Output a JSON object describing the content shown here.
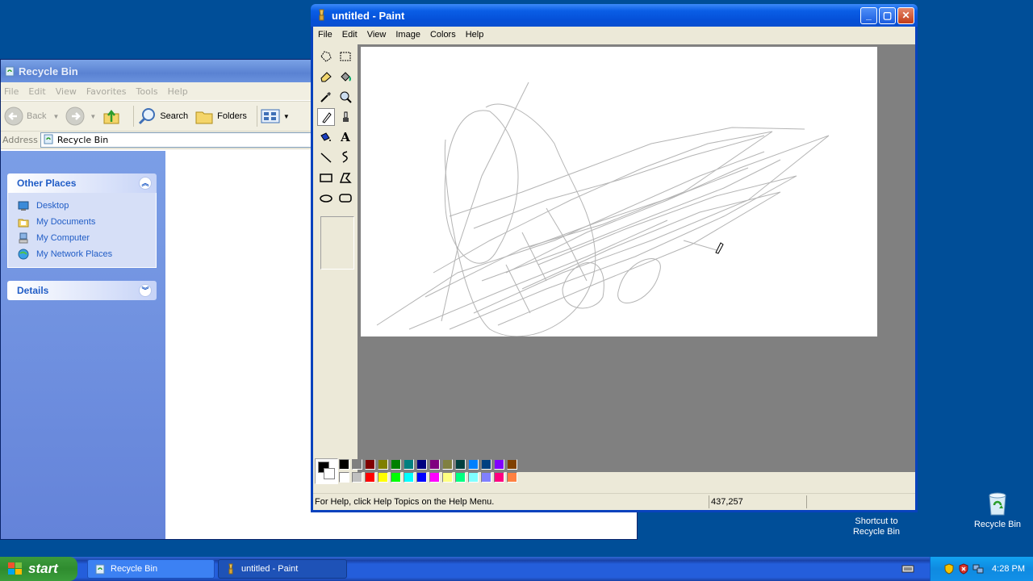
{
  "desktop": {
    "icons": [
      {
        "label": "Shortcut to Recycle Bin"
      },
      {
        "label": "Recycle Bin"
      }
    ]
  },
  "explorer": {
    "title": "Recycle Bin",
    "menu": [
      "File",
      "Edit",
      "View",
      "Favorites",
      "Tools",
      "Help"
    ],
    "toolbar": {
      "back": "Back",
      "search": "Search",
      "folders": "Folders"
    },
    "address": {
      "label": "Address",
      "value": "Recycle Bin"
    },
    "other_places": {
      "title": "Other Places",
      "items": [
        "Desktop",
        "My Documents",
        "My Computer",
        "My Network Places"
      ]
    },
    "details": {
      "title": "Details"
    }
  },
  "paint": {
    "title": "untitled - Paint",
    "menu": [
      "File",
      "Edit",
      "View",
      "Image",
      "Colors",
      "Help"
    ],
    "status": {
      "help": "For Help, click Help Topics on the Help Menu.",
      "coords": "437,257"
    },
    "palette": {
      "top": [
        "#000000",
        "#808080",
        "#800000",
        "#808000",
        "#008000",
        "#008080",
        "#000080",
        "#800080",
        "#808040",
        "#004040",
        "#0080ff",
        "#004080",
        "#8000ff",
        "#804000"
      ],
      "bottom": [
        "#ffffff",
        "#c0c0c0",
        "#ff0000",
        "#ffff00",
        "#00ff00",
        "#00ffff",
        "#0000ff",
        "#ff00ff",
        "#ffff80",
        "#00ff80",
        "#80ffff",
        "#8080ff",
        "#ff0080",
        "#ff8040"
      ]
    }
  },
  "taskbar": {
    "start": "start",
    "buttons": [
      "Recycle Bin",
      "untitled - Paint"
    ],
    "clock": "4:28 PM"
  }
}
